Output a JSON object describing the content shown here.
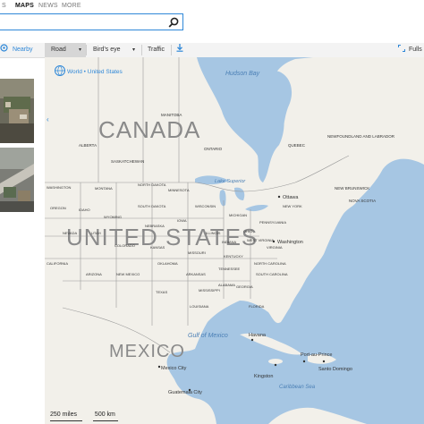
{
  "topnav": {
    "items": [
      {
        "label": "S",
        "active": false
      },
      {
        "label": "MAPS",
        "active": true
      },
      {
        "label": "NEWS",
        "active": false
      },
      {
        "label": "MORE",
        "active": false
      }
    ]
  },
  "search": {
    "value": "",
    "placeholder": "",
    "icon": "search-icon"
  },
  "toolbar": {
    "nearby": "Nearby",
    "road": "Road",
    "birds_eye": "Bird's eye",
    "traffic": "Traffic",
    "fullscreen": "Fulls",
    "download_icon": "download-icon"
  },
  "map": {
    "breadcrumb": "World • United States",
    "countries": [
      "CANADA",
      "UNITED STATES",
      "MEXICO"
    ],
    "water": [
      "Hudson Bay",
      "Gulf of Mexico",
      "Caribbean Sea",
      "Lake Superior"
    ],
    "provinces": [
      "MANITOBA",
      "ALBERTA",
      "SASKATCHEWAN",
      "ONTARIO",
      "QUEBEC",
      "NEWFOUNDLAND AND LABRADOR",
      "NEW BRUNSWICK",
      "NOVA SCOTIA"
    ],
    "states": [
      "WASHINGTON",
      "MONTANA",
      "NORTH DAKOTA",
      "MINNESOTA",
      "OREGON",
      "IDAHO",
      "SOUTH DAKOTA",
      "WISCONSIN",
      "MICHIGAN",
      "NEW YORK",
      "WYOMING",
      "NEBRASKA",
      "IOWA",
      "ILLINOIS",
      "INDIANA",
      "OHIO",
      "PENNSYLVANIA",
      "NEVADA",
      "UTAH",
      "COLORADO",
      "KANSAS",
      "MISSOURI",
      "KENTUCKY",
      "VIRGINIA",
      "WEST VIRGINIA",
      "CALIFORNIA",
      "ARIZONA",
      "NEW MEXICO",
      "OKLAHOMA",
      "TENNESSEE",
      "NORTH CAROLINA",
      "SOUTH CAROLINA",
      "ARKANSAS",
      "MISSISSIPPI",
      "ALABAMA",
      "GEORGIA",
      "TEXAS",
      "LOUISIANA",
      "FLORIDA"
    ],
    "cities": [
      "Ottawa",
      "Washington",
      "Havana",
      "Mexico City",
      "Kingston",
      "Guatemala City",
      "Port-au-Prince",
      "Santo Domingo"
    ],
    "scale_miles": "250 miles",
    "scale_km": "500 km"
  },
  "colors": {
    "water": "#a6c6e3",
    "land": "#f2f0ea",
    "border": "#8a8a8a",
    "accent": "#2f88d8"
  }
}
